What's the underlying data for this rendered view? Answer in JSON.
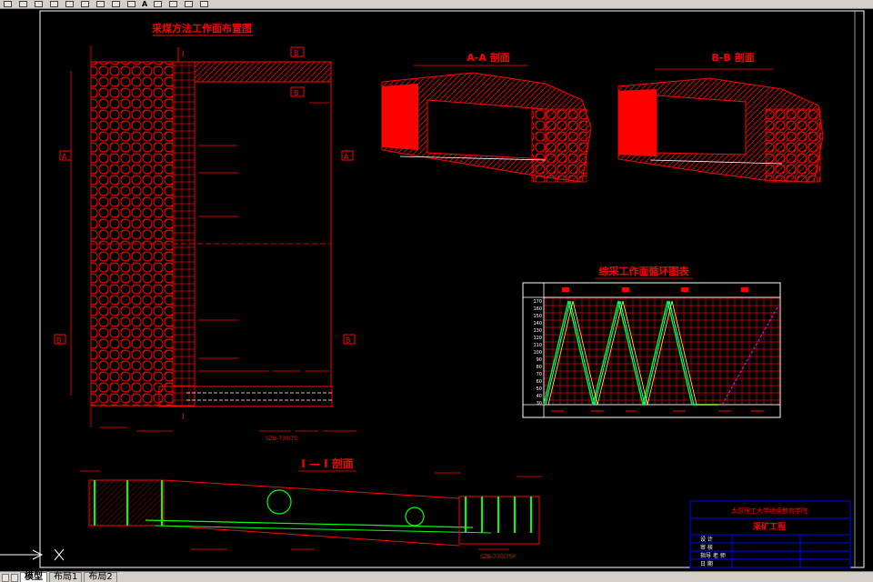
{
  "toolbar": {
    "buttons": [
      "new-icon",
      "open-icon",
      "save-icon",
      "print-icon",
      "cut-icon",
      "copy-icon",
      "paste-icon",
      "undo-icon",
      "redo-icon",
      "pan-icon",
      "zoom-icon",
      "properties-icon",
      "layer-icon"
    ],
    "text_glyph": "A"
  },
  "drawing": {
    "plan_title": "采煤方法工作面布置图",
    "aa_title": "A-A 剖面",
    "bb_title": "B-B 剖面",
    "cycle_title": "综采工作面循环图表",
    "section_title": "I — I 剖面",
    "section_label_I": "I",
    "section_label_A": "A",
    "section_label_B": "B",
    "bottom_code_1": "SZB-730/75",
    "bottom_code_2": "SZB-730/75P",
    "axis_numbers": [
      "170",
      "160",
      "150",
      "140",
      "130",
      "120",
      "110",
      "100",
      "90",
      "80",
      "70",
      "60",
      "50",
      "40",
      "30"
    ]
  },
  "title_block": {
    "school": "太原理工大学继续教育学院",
    "project": "采矿工程",
    "rows": [
      "设 计",
      "审 核",
      "指导 老 师",
      "日 期"
    ]
  },
  "tabs": {
    "model": "模型",
    "layout1": "布局1",
    "layout2": "布局2"
  },
  "colors": {
    "background": "#000000",
    "drawing": "#ff0000",
    "title_block": "#0000ff",
    "chart_cyan": "#00ffff",
    "chart_green": "#00ff00",
    "chart_yellow": "#ffff00",
    "chart_magenta": "#ff00ff"
  }
}
